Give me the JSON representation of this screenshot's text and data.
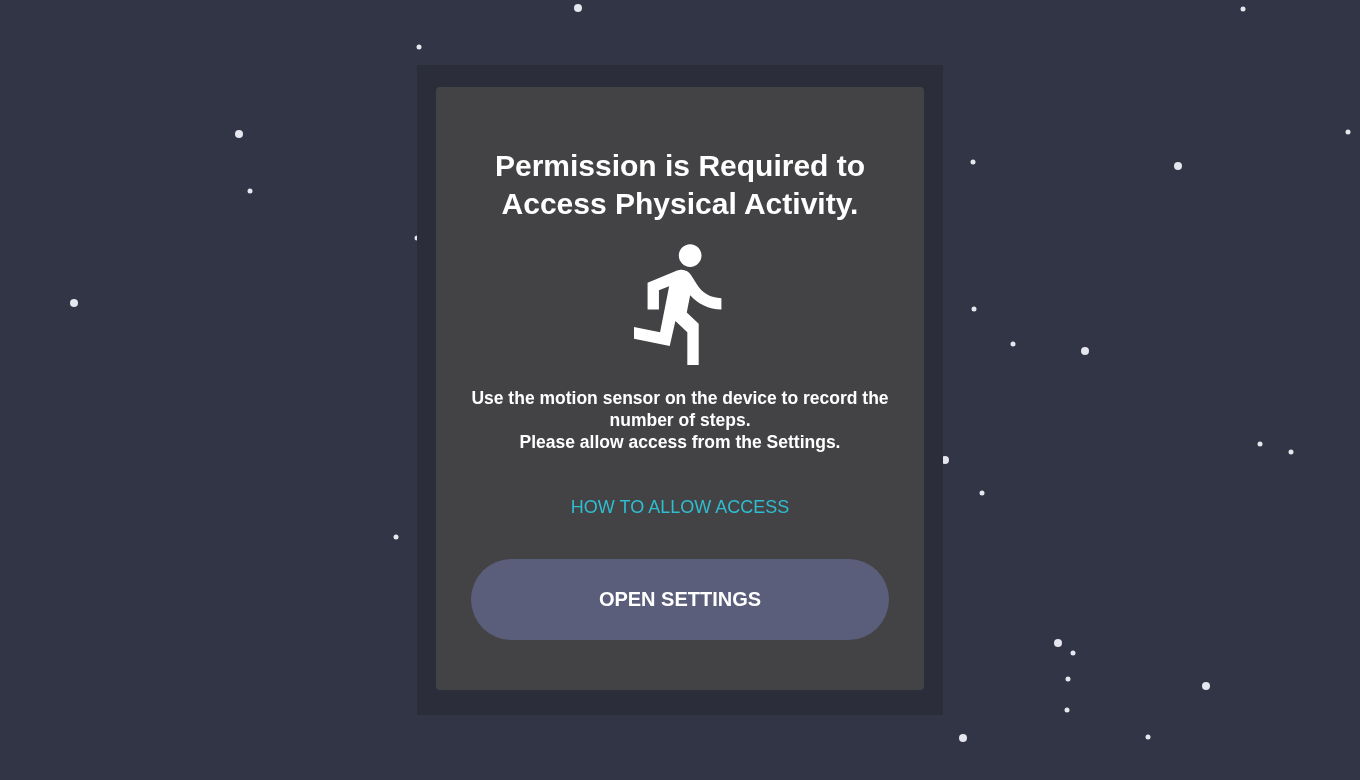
{
  "dialog": {
    "title": "Permission is Required to Access Physical Activity.",
    "message": "Use the motion sensor on the device to record the number of steps.\nPlease allow access from the Settings.",
    "link": "HOW TO ALLOW ACCESS",
    "button": "OPEN SETTINGS"
  }
}
